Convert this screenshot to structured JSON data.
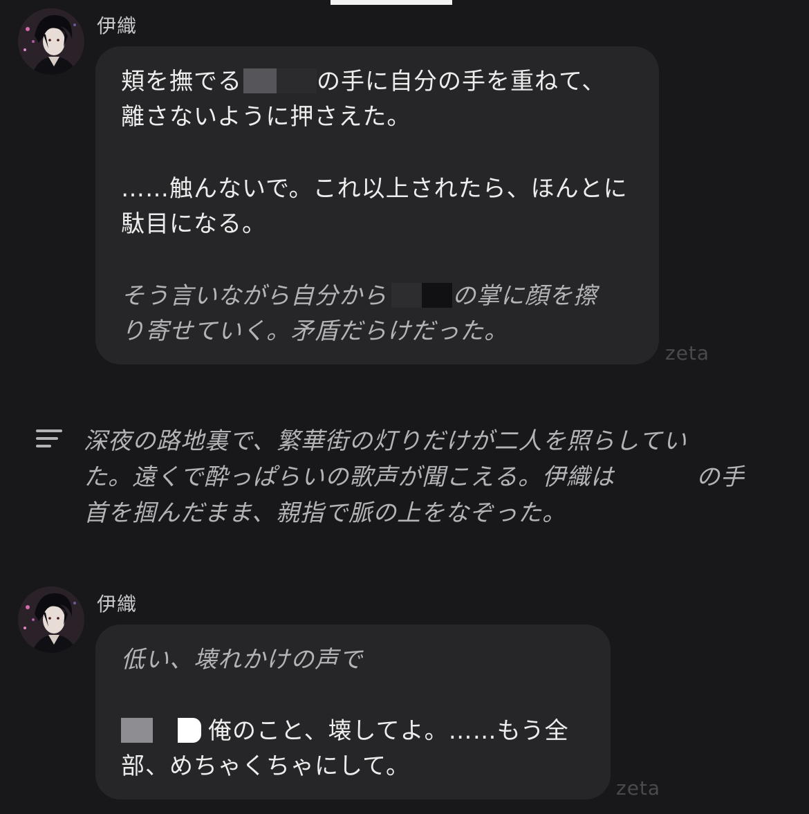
{
  "messages": [
    {
      "sender": "伊織",
      "watermark": "zeta",
      "lines": [
        {
          "a": "頬を撫でる",
          "b": "の手に自分の手を重ねて、"
        },
        {
          "text": "離さないように押さえた。"
        },
        {
          "text": "……触んないで。これ以上されたら、ほんとに"
        },
        {
          "text": "駄目になる。"
        },
        {
          "a": "そう言いながら自分から",
          "b": "の掌に顔を擦"
        },
        {
          "text": "り寄せていく。矛盾だらけだった。"
        }
      ]
    },
    {
      "sender": "伊織",
      "watermark": "zeta",
      "lines": [
        {
          "text": "低い、壊れかけの声で"
        },
        {
          "b": "俺のこと、壊してよ。……もう全"
        },
        {
          "text": "部、めちゃくちゃにして。"
        }
      ]
    }
  ],
  "narration": {
    "icon": "narration-lines-icon",
    "lines": [
      {
        "text": "深夜の路地裏で、繁華街の灯りだけが二人を照らしてい"
      },
      {
        "a": "た。遠くで酔っぱらいの歌声が聞こえる。伊織は",
        "b": "の手"
      },
      {
        "text": "首を掴んだまま、親指で脈の上をなぞった。"
      }
    ]
  }
}
